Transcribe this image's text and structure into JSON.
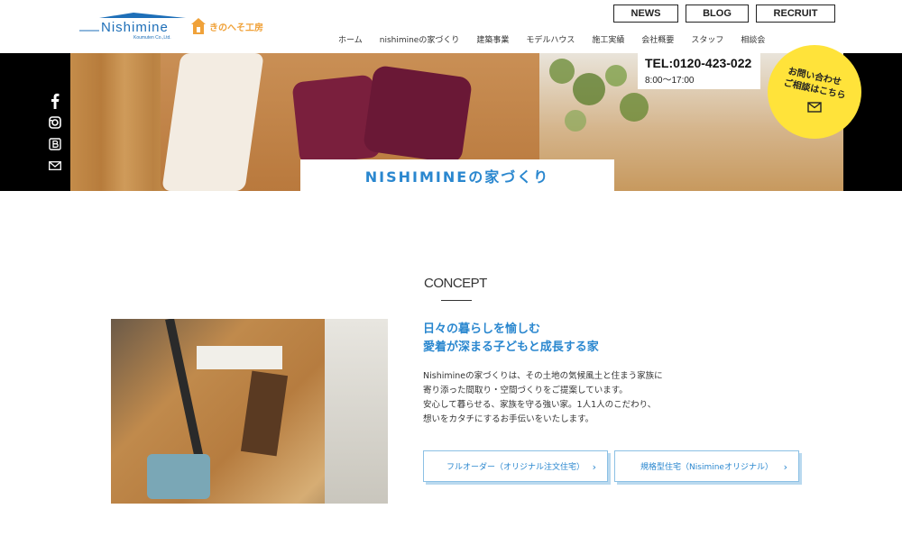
{
  "header": {
    "logo_text": "Nishimine",
    "logo_sub": "Koumuten Co.,Ltd.",
    "sister_logo_text": "きのへそ工房",
    "top_buttons": [
      "NEWS",
      "BLOG",
      "RECRUIT"
    ],
    "nav": [
      "ホーム",
      "nishimineの家づくり",
      "建築事業",
      "モデルハウス",
      "施工実績",
      "会社概要",
      "スタッフ",
      "相談会"
    ]
  },
  "hero": {
    "tel": "TEL:0120-423-022",
    "hours": "8:00～17:00",
    "contact_line1": "お問い合わせ",
    "contact_line2": "ご相談はこちら",
    "title": "NISHIMINEの家づくり"
  },
  "sns_icons": [
    "facebook-icon",
    "instagram-icon",
    "blog-icon",
    "mail-icon"
  ],
  "concept": {
    "label": "CONCEPT",
    "headline_1": "日々の暮らしを愉しむ",
    "headline_2": "愛着が深まる子どもと成長する家",
    "body_1": "Nishimineの家づくりは、その土地の気候風土と住まう家族に",
    "body_2": "寄り添った間取り・空間づくりをご提案しています。",
    "body_3": "安心して暮らせる、家族を守る強い家。1人1人のこだわり、",
    "body_4": "想いをカタチにするお手伝いをいたします。",
    "button_1": "フルオーダー（オリジナル注文住宅）",
    "button_2": "規格型住宅（Nisimineオリジナル）"
  },
  "colors": {
    "accent_blue": "#2a87cf",
    "contact_yellow": "#ffe33a",
    "sister_orange": "#f0a23a"
  }
}
